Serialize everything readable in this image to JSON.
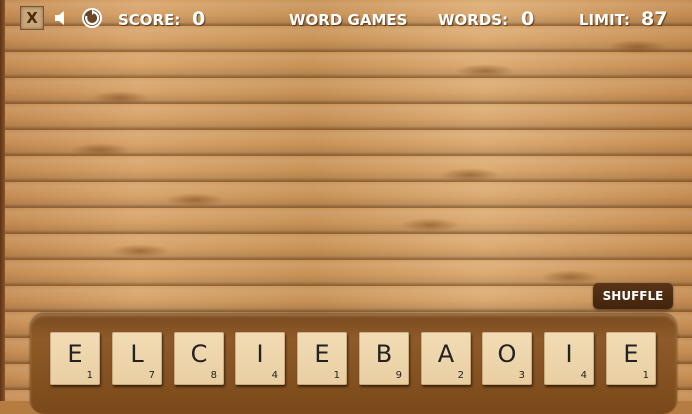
{
  "header": {
    "close_label": "X",
    "score_label": "SCORE:",
    "score_value": "0",
    "title": "WORD GAMES",
    "words_label": "WORDS:",
    "words_value": "0",
    "limit_label": "LIMIT:",
    "limit_value": "87"
  },
  "controls": {
    "shuffle_label": "SHUFFLE"
  },
  "tiles": [
    {
      "letter": "E",
      "score": "1"
    },
    {
      "letter": "L",
      "score": "7"
    },
    {
      "letter": "C",
      "score": "8"
    },
    {
      "letter": "I",
      "score": "4"
    },
    {
      "letter": "E",
      "score": "1"
    },
    {
      "letter": "B",
      "score": "9"
    },
    {
      "letter": "A",
      "score": "2"
    },
    {
      "letter": "O",
      "score": "3"
    },
    {
      "letter": "I",
      "score": "4"
    },
    {
      "letter": "E",
      "score": "1"
    }
  ],
  "icons": {
    "sound": "speaker-icon",
    "reload": "reload-icon"
  },
  "colors": {
    "wood": "#c89256",
    "tray": "#8e5a28",
    "tile": "#f2dcb5"
  }
}
